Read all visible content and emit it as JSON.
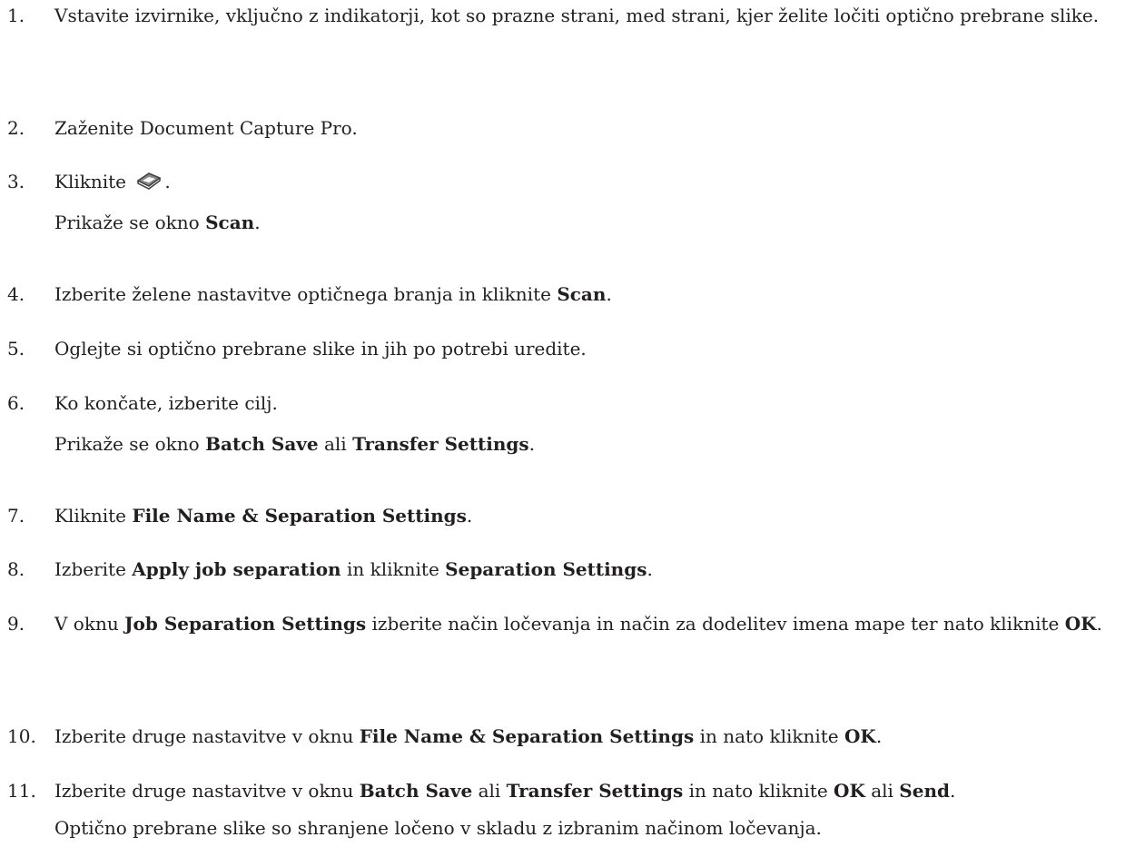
{
  "steps": [
    {
      "number": "1.",
      "text": "Vstavite izvirnike, vključno z indikatorji, kot so prazne strani, med strani, kjer želite ločiti optično prebrane slike."
    },
    {
      "number": "2.",
      "text": "Zaženite Document Capture Pro."
    },
    {
      "number": "3.",
      "text_before": "Kliknite",
      "icon": "scan-icon",
      "text_after": ".",
      "sub_before": "Prikaže se okno",
      "sub_bold": "Scan",
      "sub_after": "."
    },
    {
      "number": "4.",
      "text_before": "Izberite želene nastavitve optičnega branja in kliknite",
      "bold": "Scan",
      "text_after": "."
    },
    {
      "number": "5.",
      "text": "Oglejte si optično prebrane slike in jih po potrebi uredite."
    },
    {
      "number": "6.",
      "text": "Ko končate, izberite cilj.",
      "sub_before": "Prikaže se okno",
      "sub_bold1": "Batch Save",
      "sub_mid": "ali",
      "sub_bold2": "Transfer Settings",
      "sub_after": "."
    },
    {
      "number": "7.",
      "text_before": "Kliknite",
      "bold": "File Name & Separation Settings",
      "text_after": "."
    },
    {
      "number": "8.",
      "text_before": "Izberite",
      "bold1": "Apply job separation",
      "mid": "in kliknite",
      "bold2": "Separation Settings",
      "text_after": "."
    },
    {
      "number": "9.",
      "text_before": "V oknu",
      "bold1": "Job Separation Settings",
      "mid": "izberite način ločevanja in način za dodelitev imena mape ter nato kliknite",
      "bold2": "OK",
      "text_after": "."
    },
    {
      "number": "10.",
      "text_before": "Izberite druge nastavitve v oknu",
      "bold1": "File Name & Separation Settings",
      "mid": "in nato kliknite",
      "bold2": "OK",
      "text_after": "."
    },
    {
      "number": "11.",
      "text_before": "Izberite druge nastavitve v oknu",
      "bold1": "Batch Save",
      "mid1": "ali",
      "bold2": "Transfer Settings",
      "mid2": "in nato kliknite",
      "bold3": "OK",
      "mid3": "ali",
      "bold4": "Send",
      "text_after": ".",
      "sub": "Optično prebrane slike so shranjene ločeno v skladu z izbranim načinom ločevanja."
    }
  ]
}
